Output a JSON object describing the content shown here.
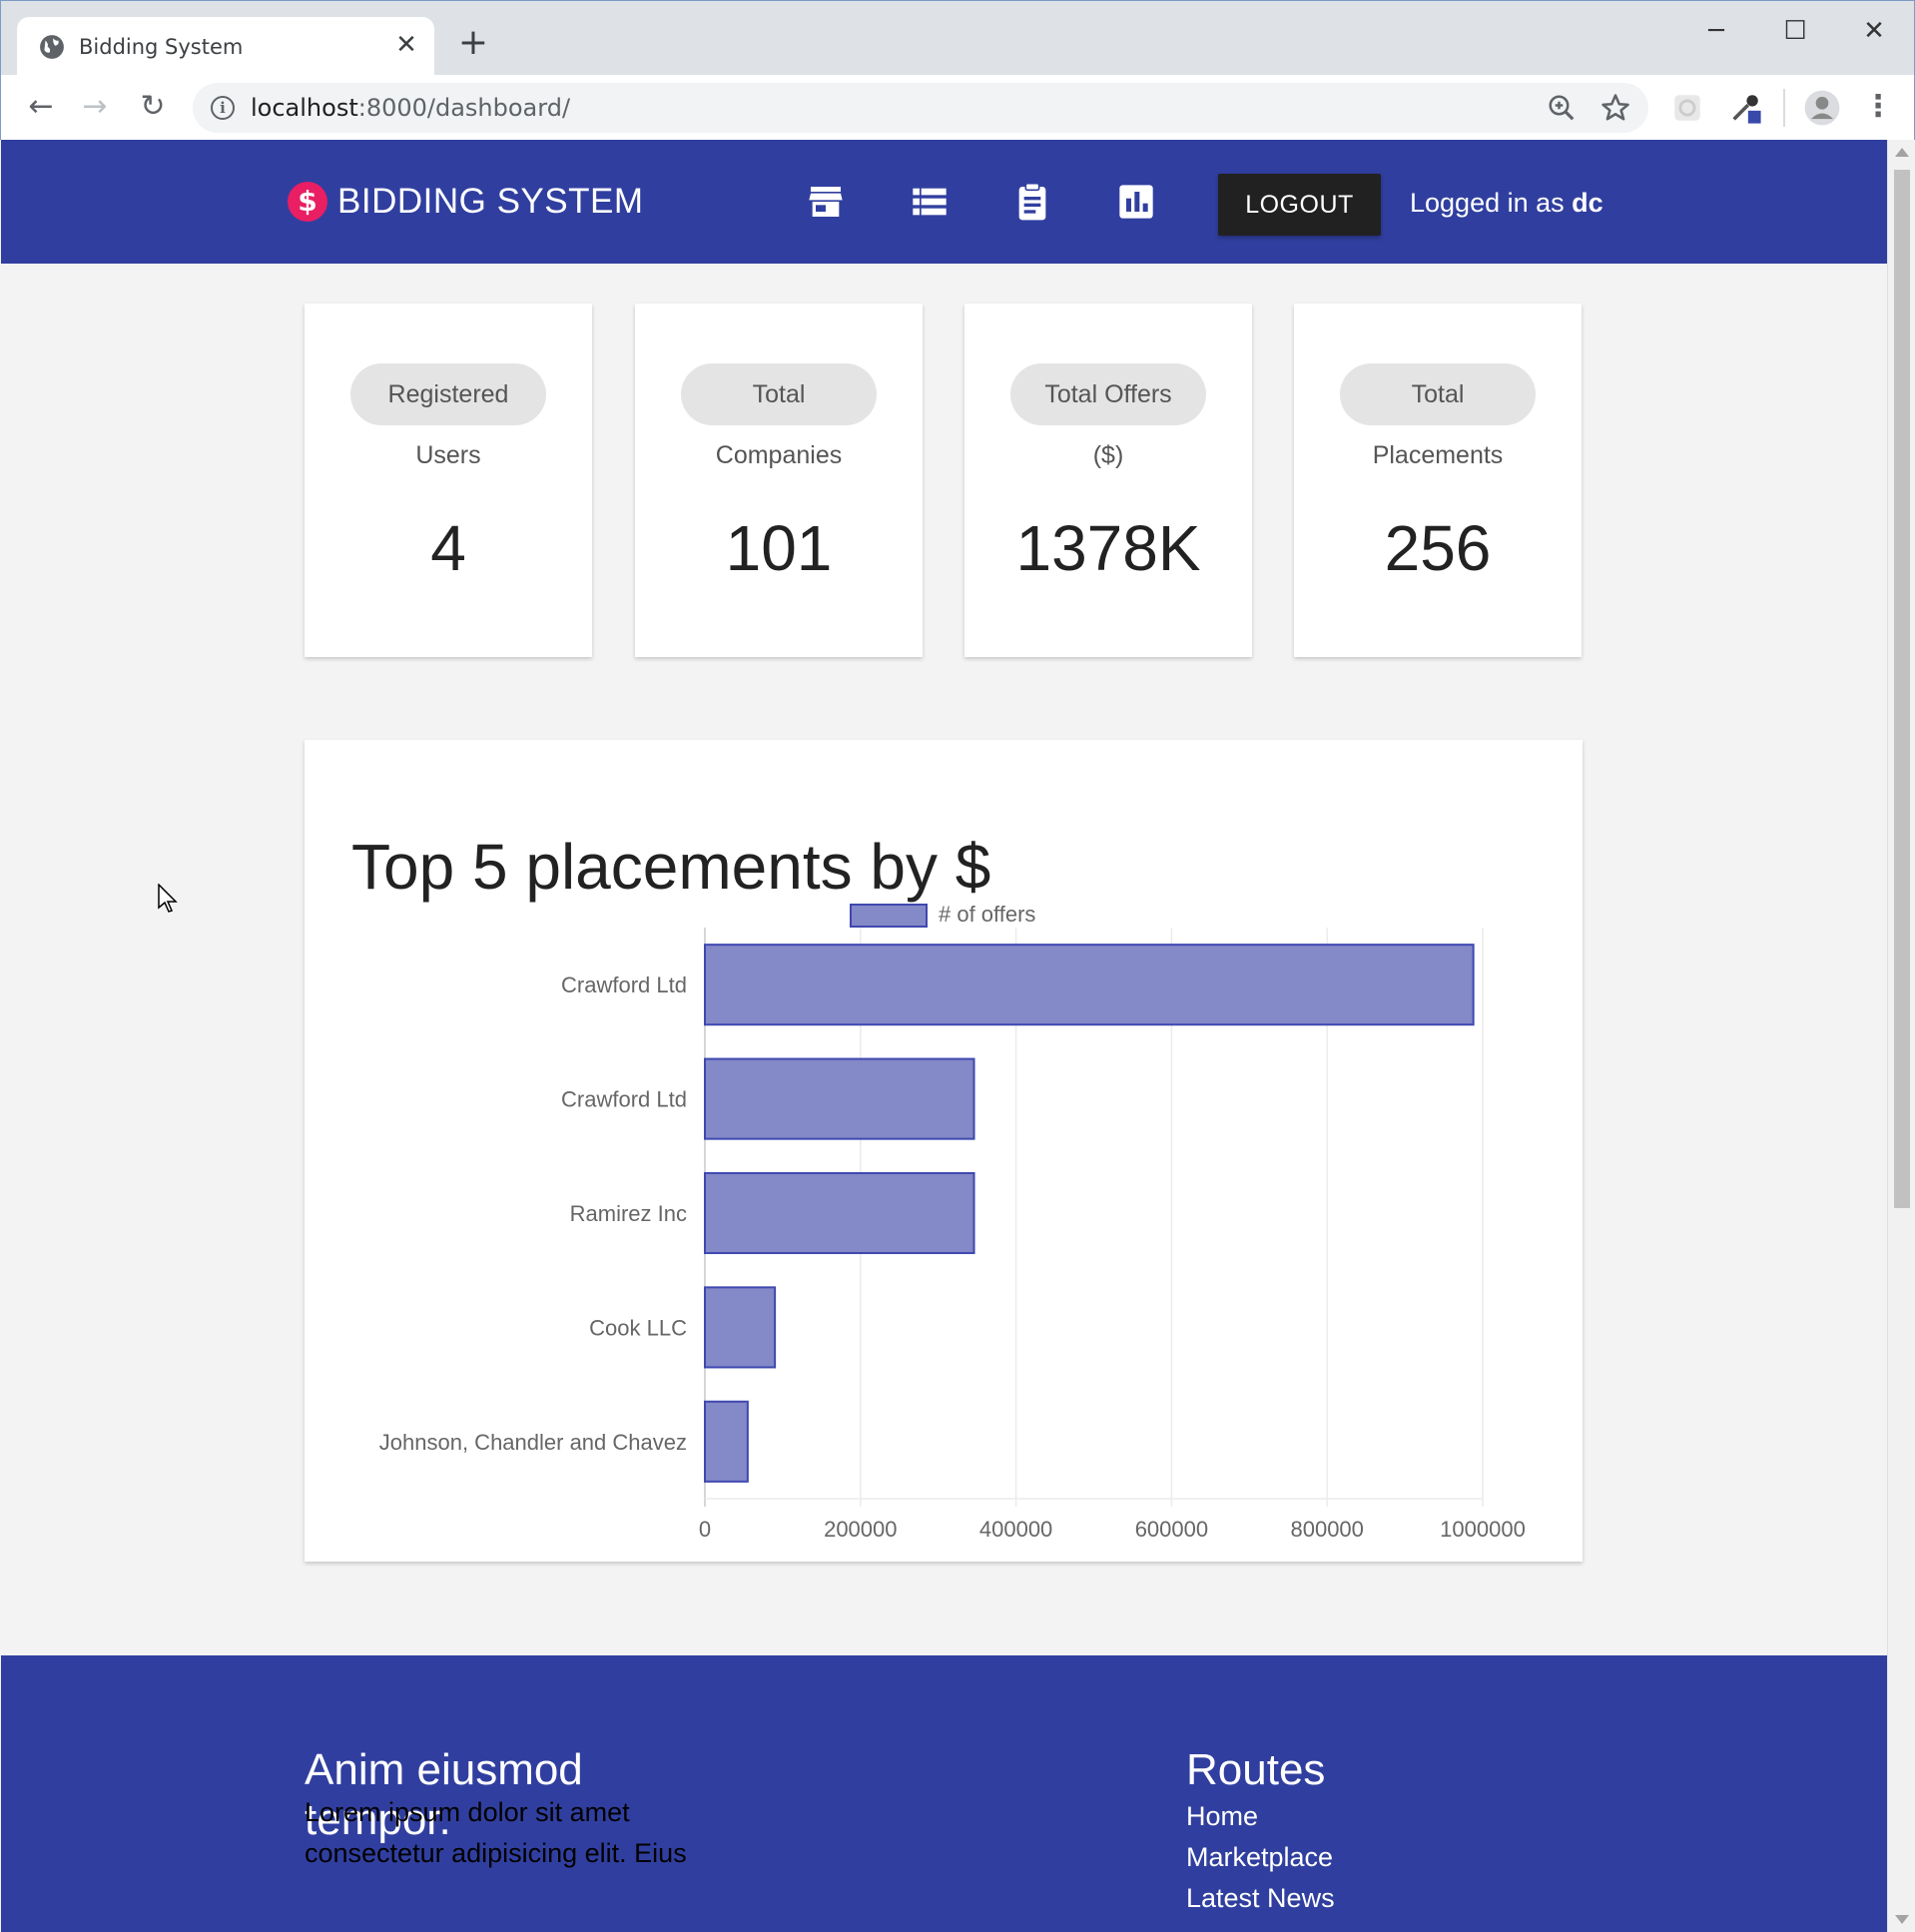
{
  "browser": {
    "tab_title": "Bidding System",
    "url_host": "localhost",
    "url_path": ":8000/dashboard/"
  },
  "navbar": {
    "brand": "BIDDING SYSTEM",
    "brand_logo": "$",
    "icons": [
      "store-icon",
      "list-icon",
      "clipboard-icon",
      "bar-chart-icon"
    ],
    "logout_label": "LOGOUT",
    "logged_in_prefix": "Logged in as",
    "username": "dc",
    "bg_color": "#303f9f",
    "logo_color": "#e91e63"
  },
  "stats": [
    {
      "chip": "Registered",
      "sub": "Users",
      "value": "4"
    },
    {
      "chip": "Total",
      "sub": "Companies",
      "value": "101"
    },
    {
      "chip": "Total Offers",
      "sub": "($)",
      "value": "1378K"
    },
    {
      "chip": "Total",
      "sub": "Placements",
      "value": "256"
    }
  ],
  "chart": {
    "title": "Top 5 placements by $"
  },
  "chart_data": {
    "type": "bar",
    "orientation": "horizontal",
    "categories": [
      "Crawford Ltd",
      "Crawford Ltd",
      "Ramirez Inc",
      "Cook LLC",
      "Johnson, Chandler and Chavez"
    ],
    "series": [
      {
        "name": "# of offers",
        "values": [
          988000,
          346000,
          346000,
          90000,
          55000
        ],
        "color": "#8489c7",
        "border": "#3f48b0"
      }
    ],
    "xlim": [
      0,
      1000000
    ],
    "x_ticks": [
      "0",
      "200000",
      "400000",
      "600000",
      "800000",
      "1000000"
    ],
    "grid": true,
    "legend": "top-center"
  },
  "footer": {
    "heading_line1": "Anim eiusmod",
    "heading_line2": "tempor.",
    "text": "Lorem ipsum dolor sit amet consectetur adipisicing elit. Eius",
    "routes_heading": "Routes",
    "links": [
      "Home",
      "Marketplace",
      "Latest News"
    ]
  }
}
